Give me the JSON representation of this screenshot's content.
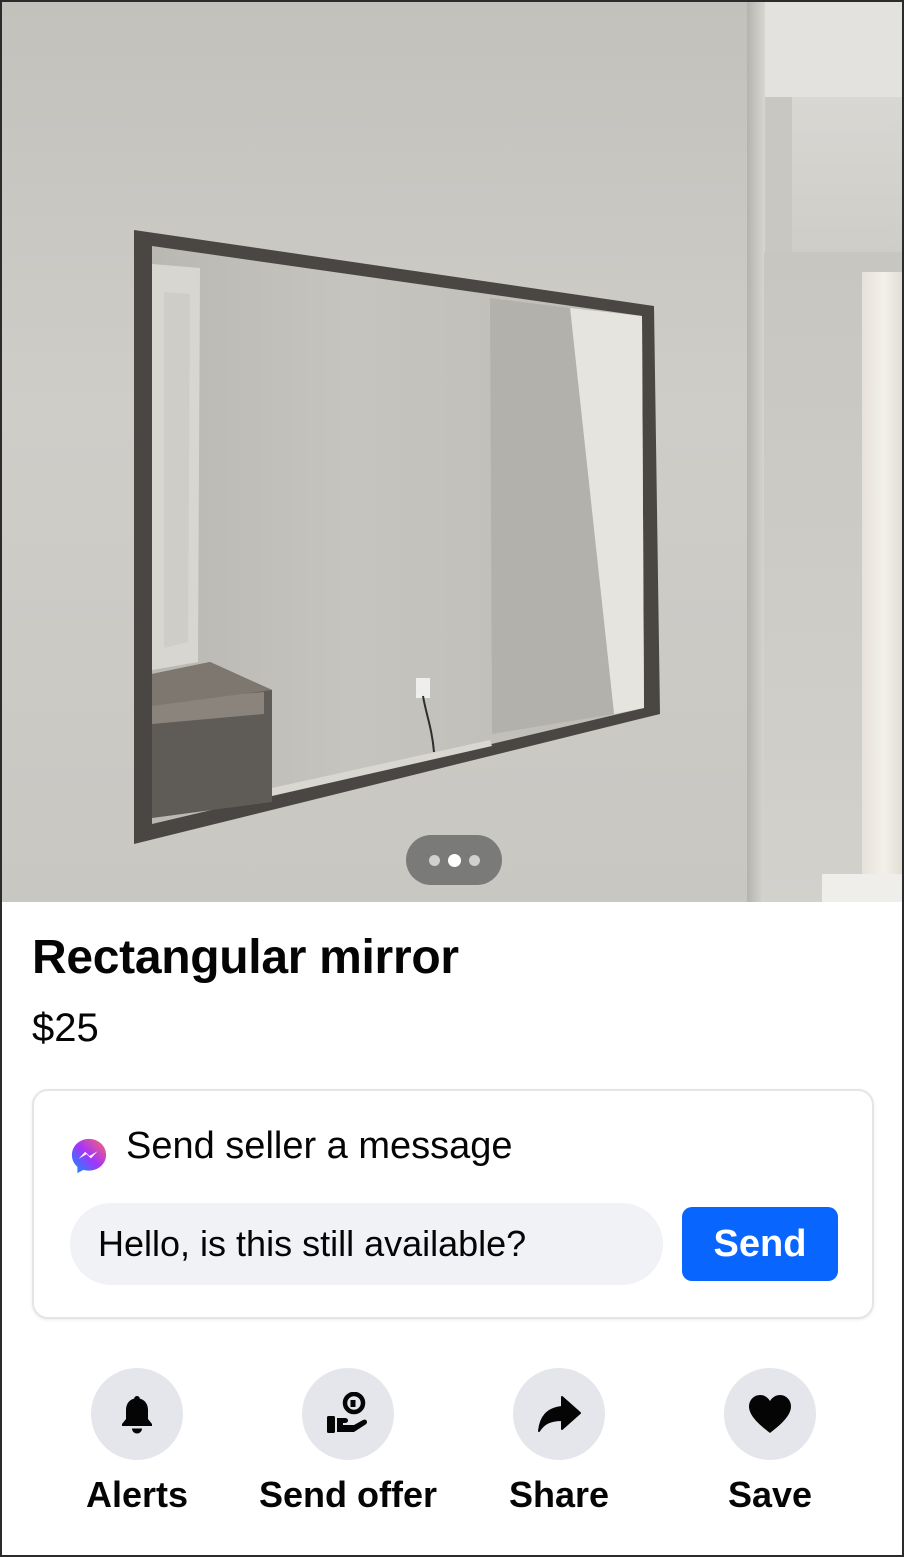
{
  "listing": {
    "photo_alt": "Rectangular mirror photo",
    "title": "Rectangular mirror",
    "price": "$25",
    "photo_count": 3,
    "active_photo_index": 2
  },
  "message": {
    "header": "Send seller a message",
    "input_value": "Hello, is this still available?",
    "send_label": "Send"
  },
  "actions": [
    {
      "label": "Alerts",
      "icon": "bell-icon"
    },
    {
      "label": "Send offer",
      "icon": "offer-icon"
    },
    {
      "label": "Share",
      "icon": "share-icon"
    },
    {
      "label": "Save",
      "icon": "heart-icon"
    }
  ],
  "colors": {
    "accent": "#0866ff",
    "action_bg": "#e4e6eb",
    "input_bg": "#f0f2f5"
  }
}
